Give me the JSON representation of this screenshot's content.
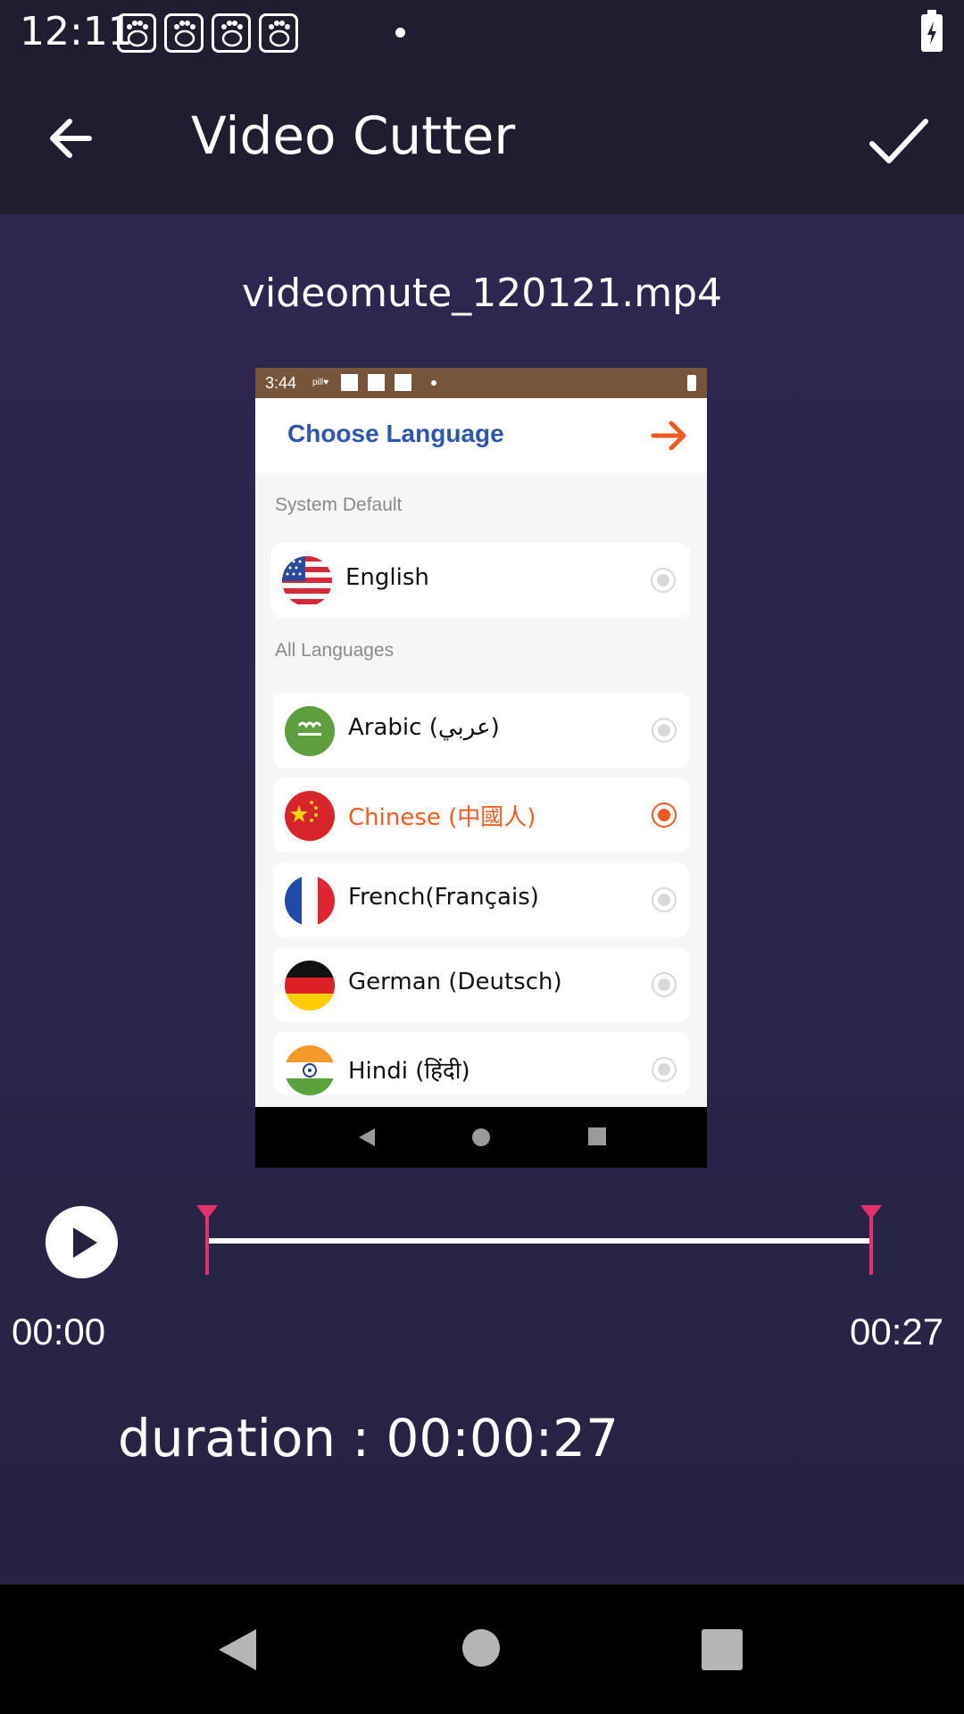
{
  "status_bar": {
    "time": "12:11",
    "notification_icons": [
      "baidu-paw-icon",
      "baidu-paw-icon",
      "baidu-paw-icon",
      "baidu-paw-icon"
    ],
    "battery_icon": "battery-charging-icon"
  },
  "app_bar": {
    "title": "Video Cutter",
    "back_icon": "arrow-left-icon",
    "confirm_icon": "check-icon"
  },
  "file_name": "videomute_120121.mp4",
  "preview": {
    "status_time": "3:44",
    "status_small_label": "pill♥",
    "header_title": "Choose Language",
    "section_system": "System Default",
    "section_all": "All Languages",
    "system_language": {
      "label": "English",
      "flag": "us-flag-icon",
      "selected": false
    },
    "languages": [
      {
        "label": "Arabic (عربي)",
        "flag": "saudi-flag-icon",
        "selected": false
      },
      {
        "label": "Chinese (中國人)",
        "flag": "china-flag-icon",
        "selected": true
      },
      {
        "label": "French(Français)",
        "flag": "france-flag-icon",
        "selected": false
      },
      {
        "label": "German (Deutsch)",
        "flag": "germany-flag-icon",
        "selected": false
      },
      {
        "label": "Hindi (हिंदी)",
        "flag": "india-flag-icon",
        "selected": false
      }
    ],
    "colors": {
      "title": "#2e55b0",
      "accent": "#f35a1f",
      "status_bar": "#76553a"
    }
  },
  "player": {
    "play_icon": "play-icon",
    "start_time": "00:00",
    "end_time": "00:27",
    "range_start_fraction": 0.0,
    "range_end_fraction": 1.0,
    "marker_color": "#e72f6f"
  },
  "duration_text": "duration : 00:00:27",
  "nav_bar": {
    "icons": [
      "back-triangle-icon",
      "home-circle-icon",
      "recents-square-icon"
    ]
  }
}
